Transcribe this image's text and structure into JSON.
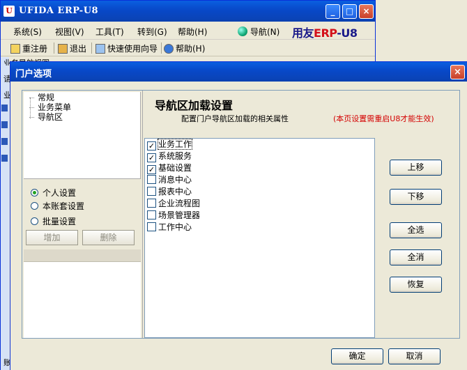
{
  "main_window": {
    "logo": "U",
    "title": "UFIDA ERP-U8",
    "controls": {
      "minimize": "_",
      "maximize": "□",
      "close": "×"
    },
    "menu": [
      {
        "label": "系统(S)"
      },
      {
        "label": "视图(V)"
      },
      {
        "label": "工具(T)"
      },
      {
        "label": "转到(G)"
      },
      {
        "label": "帮助(H)"
      }
    ],
    "nav_link": "导航(N)",
    "brand_prefix": "用友",
    "brand_erp": "ERP",
    "brand_suffix": "-U8",
    "toolbar": [
      {
        "label": "重注册"
      },
      {
        "label": "退出"
      },
      {
        "label": "快速使用向导"
      },
      {
        "label": "帮助(H)"
      }
    ],
    "bg_tab_fragment": "业务导航视图",
    "bg_fragment_1": "请",
    "bg_fragment_2": "业",
    "bg_bottom_fragment": "账"
  },
  "dialog": {
    "title": "门户选项",
    "close": "×",
    "tree": [
      {
        "label": "常规"
      },
      {
        "label": "业务菜单"
      },
      {
        "label": "导航区"
      }
    ],
    "radios": [
      {
        "label": "个人设置",
        "selected": true
      },
      {
        "label": "本账套设置",
        "selected": false
      },
      {
        "label": "批量设置",
        "selected": false
      }
    ],
    "add_button": "增加",
    "delete_button": "删除",
    "panel_title": "导航区加载设置",
    "panel_subtitle": "配置门户导航区加载的相关属性",
    "panel_note": "(本页设置需重启U8才能生效)",
    "items": [
      {
        "label": "业务工作",
        "checked": true
      },
      {
        "label": "系统服务",
        "checked": true
      },
      {
        "label": "基础设置",
        "checked": true
      },
      {
        "label": "消息中心",
        "checked": false
      },
      {
        "label": "报表中心",
        "checked": false
      },
      {
        "label": "企业流程图",
        "checked": false
      },
      {
        "label": "场景管理器",
        "checked": false
      },
      {
        "label": "工作中心",
        "checked": false
      }
    ],
    "buttons": {
      "move_up": "上移",
      "move_down": "下移",
      "select_all": "全选",
      "deselect_all": "全消",
      "restore": "恢复",
      "ok": "确定",
      "cancel": "取消"
    }
  }
}
